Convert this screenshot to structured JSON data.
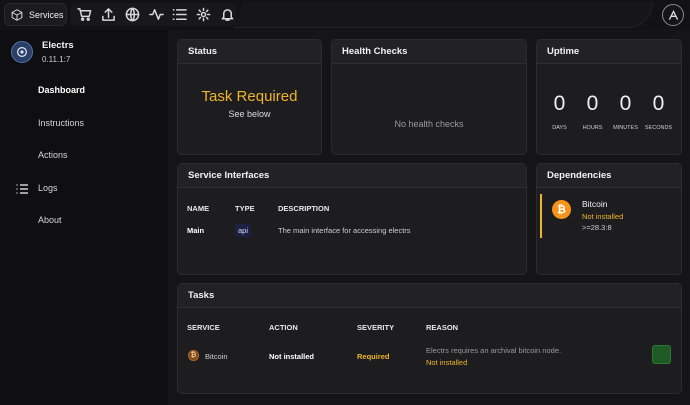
{
  "topbar": {
    "brand_label": "Services",
    "icons": [
      "cart-icon",
      "upload-icon",
      "globe-icon",
      "activity-icon",
      "list-icon",
      "gear-icon",
      "bell-icon"
    ],
    "logo_icon": "start9-logo-icon"
  },
  "service": {
    "name": "Electrs",
    "version": "0.11.1:7"
  },
  "sidebar": {
    "items": [
      {
        "label": "Dashboard",
        "active": true
      },
      {
        "label": "Instructions"
      },
      {
        "label": "Actions"
      },
      {
        "label": "Logs",
        "icon": "list-icon"
      },
      {
        "label": "About"
      }
    ]
  },
  "status": {
    "title": "Status",
    "state": "Task Required",
    "subtext": "See below"
  },
  "health": {
    "title": "Health Checks",
    "empty_text": "No health checks"
  },
  "uptime": {
    "title": "Uptime",
    "cells": [
      {
        "value": "0",
        "label": "DAYS"
      },
      {
        "value": "0",
        "label": "HOURS"
      },
      {
        "value": "0",
        "label": "MINUTES"
      },
      {
        "value": "0",
        "label": "SECONDS"
      }
    ]
  },
  "interfaces": {
    "title": "Service Interfaces",
    "columns": [
      "NAME",
      "TYPE",
      "DESCRIPTION"
    ],
    "rows": [
      {
        "name": "Main",
        "type": "api",
        "description": "The main interface for accessing electrs"
      }
    ]
  },
  "dependencies": {
    "title": "Dependencies",
    "items": [
      {
        "name": "Bitcoin",
        "status": "Not installed",
        "version": ">=28.3:8",
        "icon": "bitcoin-icon"
      }
    ]
  },
  "tasks": {
    "title": "Tasks",
    "columns": [
      "SERVICE",
      "ACTION",
      "SEVERITY",
      "REASON"
    ],
    "rows": [
      {
        "service": "Bitcoin",
        "action": "Not installed",
        "severity": "Required",
        "reason": "Electrs requires an archival bitcoin node.",
        "reason_status": "Not installed"
      }
    ]
  },
  "colors": {
    "accent_warning": "#f0b429",
    "bitcoin": "#f7931a",
    "success": "#1e5a23"
  }
}
